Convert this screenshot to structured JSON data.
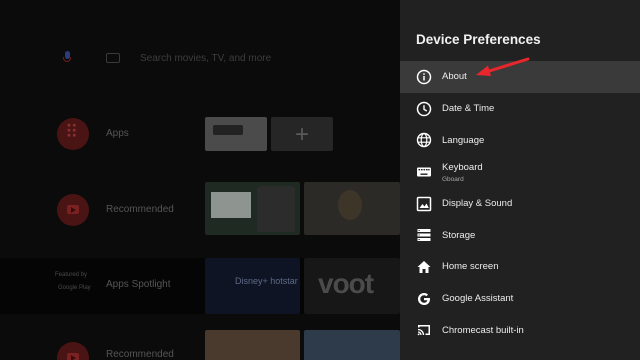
{
  "home": {
    "search_placeholder": "Search movies, TV, and more",
    "rows": {
      "apps_label": "Apps",
      "recommended_label": "Recommended",
      "spotlight_label": "Apps Spotlight",
      "featured_by": "Featured by",
      "google_play": "Google Play",
      "bottom_label": "Recommended"
    },
    "tiles": {
      "hotstar": "Disney+ hotstar",
      "voot": "voot"
    }
  },
  "panel": {
    "title": "Device Preferences",
    "items": [
      {
        "label": "About",
        "icon": "info-icon",
        "selected": true
      },
      {
        "label": "Date & Time",
        "icon": "clock-icon"
      },
      {
        "label": "Language",
        "icon": "globe-icon"
      },
      {
        "label": "Keyboard",
        "sublabel": "Gboard",
        "icon": "keyboard-icon"
      },
      {
        "label": "Display & Sound",
        "icon": "image-icon"
      },
      {
        "label": "Storage",
        "icon": "storage-icon"
      },
      {
        "label": "Home screen",
        "icon": "home-icon"
      },
      {
        "label": "Google Assistant",
        "icon": "google-icon"
      },
      {
        "label": "Chromecast built-in",
        "icon": "cast-icon"
      }
    ]
  },
  "annotation": {
    "color": "#e8262b"
  }
}
